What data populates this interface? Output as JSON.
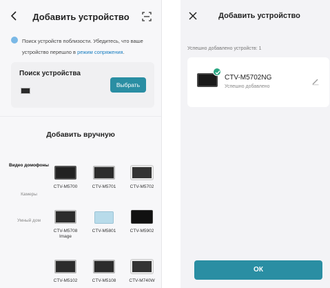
{
  "left_screen": {
    "header": {
      "title": "Добавить устройство"
    },
    "info": {
      "text_before": "Поиск устройств поблизости. Убедитесь, что ваше устройство перешло в ",
      "link": "режим сопряжения",
      "text_after": "."
    },
    "search": {
      "title": "Поиск устройства",
      "button_label": "Выбрать"
    },
    "manual": {
      "title": "Добавить вручную"
    },
    "categories": [
      {
        "label": "Видео домофоны",
        "active": true
      },
      {
        "label": "Камеры",
        "active": false
      },
      {
        "label": "Умный дом",
        "active": false
      }
    ],
    "devices": [
      {
        "name": "CTV-M5700"
      },
      {
        "name": "CTV-M5701"
      },
      {
        "name": "CTV-M5702"
      },
      {
        "name": "CTV-M5708 Image"
      },
      {
        "name": "CTV-M5801"
      },
      {
        "name": "CTV-M5902"
      },
      {
        "name": "CTV-M5102"
      },
      {
        "name": "CTV-M5108"
      },
      {
        "name": "CTV-M740W"
      }
    ]
  },
  "right_screen": {
    "header": {
      "title": "Добавить устройство"
    },
    "added_count_text": "Успешно добавлено устройств: 1",
    "device": {
      "name": "CTV-M5702NG",
      "status": "Успешно добавлено"
    },
    "ok_label": "ОК"
  },
  "colors": {
    "accent": "#2a8ea3",
    "success": "#2aa682",
    "link": "#1a7fc1"
  }
}
